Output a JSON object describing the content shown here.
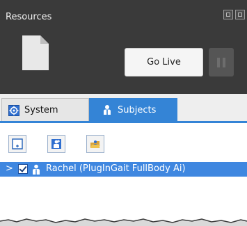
{
  "header": {
    "title": "Resources"
  },
  "controls": {
    "go_live_label": "Go Live"
  },
  "tabs": [
    {
      "label": "System",
      "selected": false
    },
    {
      "label": "Subjects",
      "selected": true
    }
  ],
  "tree": {
    "rows": [
      {
        "expander": ">",
        "checked": true,
        "label": "Rachel (PlugInGait FullBody Ai)"
      }
    ]
  },
  "colors": {
    "panel_dark": "#3a3a3a",
    "accent_blue": "#3484d6",
    "row_highlight": "#3f87e0"
  },
  "icons": [
    "window-restore-icon",
    "window-float-icon",
    "document-icon",
    "pause-icon",
    "system-icon",
    "subject-person-icon",
    "add-subject-icon",
    "add-subject-from-template-icon",
    "open-folder-icon"
  ]
}
